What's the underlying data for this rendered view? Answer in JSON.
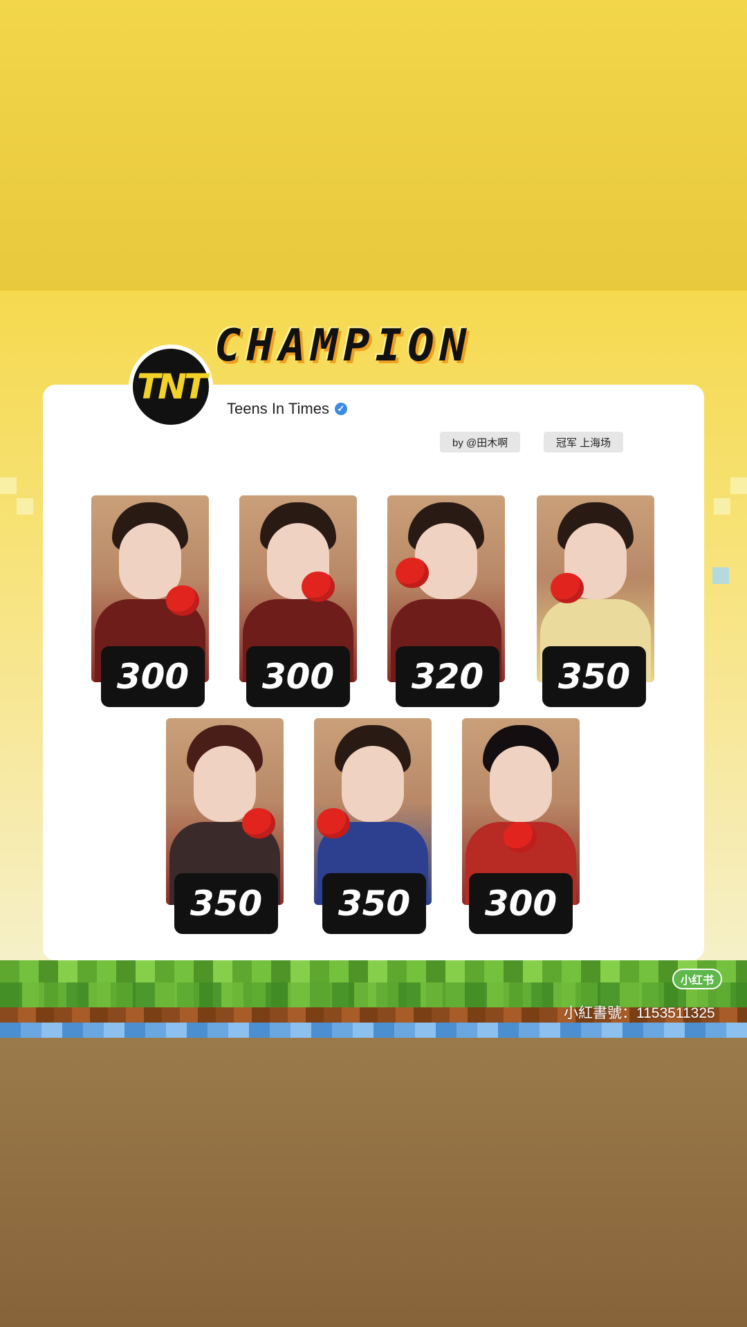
{
  "header": {
    "title": "CHAMPION",
    "logo_text": "TNT"
  },
  "account": {
    "name": "Teens In Times",
    "verified_icon": "verified-badge-icon"
  },
  "tags": [
    {
      "label": "by @田木啊"
    },
    {
      "label": "冠军 上海场"
    }
  ],
  "cards": [
    {
      "price": "300"
    },
    {
      "price": "300"
    },
    {
      "price": "320"
    },
    {
      "price": "350"
    },
    {
      "price": "350"
    },
    {
      "price": "350"
    },
    {
      "price": "300"
    }
  ],
  "footer": {
    "app_badge": "小红书",
    "id_text": "小紅書號：1153511325"
  },
  "colors": {
    "sky": "#f3d64a",
    "grass": "#5ea82f",
    "price_bg": "#111111",
    "logo_yellow": "#f2d228"
  }
}
